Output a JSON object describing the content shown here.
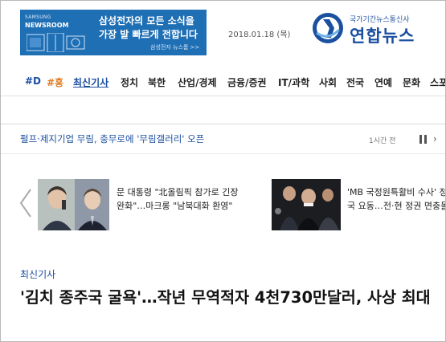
{
  "banner": {
    "brand": "SAMSUNG",
    "newsroom": "NEWSROOM",
    "line1": "삼성전자의 모든 소식을",
    "line2": "가장 발 빠르게 전합니다",
    "link": "삼성전자 뉴스룸 >>"
  },
  "date": "2018.01.18 (목)",
  "logo": {
    "tagline": "국가기간뉴스통신사",
    "name": "연합뉴스"
  },
  "nav": {
    "items": [
      {
        "label": "#D"
      },
      {
        "label": "#흥"
      },
      {
        "label": "최신기사"
      },
      {
        "label": "정치"
      },
      {
        "label": "북한"
      },
      {
        "label": "산업/경제"
      },
      {
        "label": "금융/증권"
      },
      {
        "label": "IT/과학"
      },
      {
        "label": "사회"
      },
      {
        "label": "전국"
      },
      {
        "label": "연예"
      },
      {
        "label": "문화"
      },
      {
        "label": "스포"
      }
    ]
  },
  "ticker": {
    "text": "펄프·제지기업 무림, 충무로에 '무림갤러리' 오픈",
    "time": "1시간 전"
  },
  "icons": {
    "pause": "pause-icon",
    "next": "chevron-right-icon",
    "prev": "chevron-left-icon"
  },
  "feature": {
    "story1": "문 대통령 \"北올림픽 참가로 긴장완화\"…마크롱 \"남북대화 환영\"",
    "story2": "'MB 국정원특활비 수사' 정국 요동…전·현 정권 면충돌"
  },
  "section": {
    "label": "최신기사",
    "headline": "'김치 종주국 굴욕'…작년 무역적자 4천730만달러, 사상 최대"
  },
  "colors": {
    "brand_blue": "#1b4fa0",
    "banner_blue": "#1f6fb5",
    "hashtag_orange": "#e07a1f"
  }
}
